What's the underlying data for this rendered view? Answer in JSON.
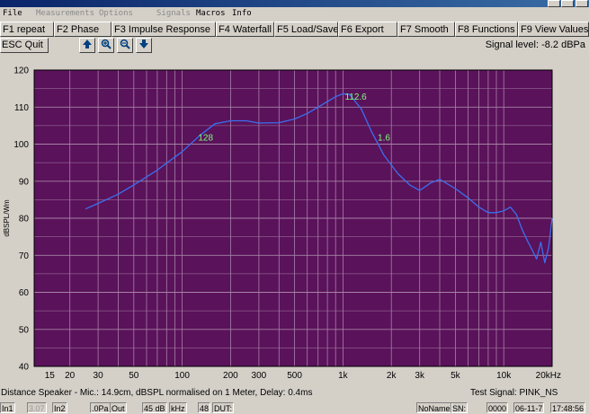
{
  "menu": [
    {
      "label": "File",
      "enabled": true
    },
    {
      "label": "Measurements",
      "enabled": false
    },
    {
      "label": "Options",
      "enabled": false
    },
    {
      "label": "Signals",
      "enabled": false
    },
    {
      "label": "Macros",
      "enabled": true
    },
    {
      "label": "Info",
      "enabled": true
    }
  ],
  "function_keys": [
    "F1 repeat",
    "F2 Phase",
    "F3 Impulse Response",
    "F4 Waterfall",
    "F5 Load/Save",
    "F6 Export",
    "F7 Smooth",
    "F8 Functions",
    "F9 View Values"
  ],
  "toolbar": {
    "quit_label": "ESC Quit",
    "icons": [
      "arrow-up-icon",
      "zoom-in-icon",
      "zoom-out-icon",
      "arrow-down-icon"
    ],
    "signal_level": "Signal level: -8.2 dBPa"
  },
  "status_bar": {
    "info": "Distance Speaker - Mic.: 14.9cm, dBSPL normalised on 1 Meter, Delay: 0.4ms",
    "test_signal": "Test Signal: PINK_NS"
  },
  "bottom_bar": {
    "cells": [
      "In1",
      "3.07",
      "In2",
      ".0Pa",
      "Out",
      "45 dB",
      "kHz",
      "48",
      "DUT:"
    ],
    "right": [
      "NoName",
      "SN:",
      "0000",
      "06-11-7",
      "17:48:56"
    ]
  },
  "colors": {
    "plot_bg": "#5a125a",
    "grid": "#a583a5",
    "curve": "#3b6ff0",
    "label_green": "#7cff7c"
  },
  "chart_data": {
    "type": "line",
    "title": "",
    "xlabel": "",
    "ylabel": "dBSPL/Wm",
    "x_scale": "log",
    "xlim": [
      12,
      20000
    ],
    "ylim": [
      40,
      120
    ],
    "grid": true,
    "x_ticks": [
      {
        "v": 15,
        "label": "15"
      },
      {
        "v": 20,
        "label": "20"
      },
      {
        "v": 30,
        "label": "30"
      },
      {
        "v": 50,
        "label": "50"
      },
      {
        "v": 100,
        "label": "100"
      },
      {
        "v": 200,
        "label": "200"
      },
      {
        "v": 300,
        "label": "300"
      },
      {
        "v": 500,
        "label": "500"
      },
      {
        "v": 1000,
        "label": "1k"
      },
      {
        "v": 2000,
        "label": "2k"
      },
      {
        "v": 3000,
        "label": "3k"
      },
      {
        "v": 5000,
        "label": "5k"
      },
      {
        "v": 10000,
        "label": "10k"
      },
      {
        "v": 20000,
        "label": "20kHz"
      }
    ],
    "y_ticks": [
      40,
      50,
      60,
      70,
      80,
      90,
      100,
      110,
      120
    ],
    "series": [
      {
        "name": "",
        "x": [
          25,
          30,
          40,
          50,
          70,
          100,
          130,
          160,
          200,
          250,
          300,
          400,
          500,
          600,
          700,
          800,
          900,
          1000,
          1100,
          1300,
          1500,
          1800,
          2200,
          2600,
          3000,
          3500,
          4000,
          5000,
          6000,
          7000,
          8000,
          9000,
          10000,
          11000,
          12000,
          13000,
          14000,
          15000,
          16000,
          17000,
          18000,
          19000,
          20000
        ],
        "y": [
          82.5,
          84,
          86.5,
          89,
          93,
          98,
          102.5,
          105.5,
          106.3,
          106.3,
          105.7,
          105.8,
          106.8,
          108.3,
          110,
          111.5,
          112.8,
          113.6,
          113.4,
          109.5,
          103.5,
          97,
          92,
          89,
          87.5,
          89.5,
          90.5,
          88,
          85.5,
          83,
          81.5,
          81.5,
          82,
          83,
          81,
          77,
          74,
          71.5,
          69,
          73.5,
          68,
          72,
          80
        ]
      }
    ],
    "annotations": [
      {
        "text": "128",
        "x": 140,
        "y": 102
      },
      {
        "text": "112.6",
        "x": 1200,
        "y": 113
      },
      {
        "text": "1.6",
        "x": 1800,
        "y": 102
      }
    ]
  }
}
